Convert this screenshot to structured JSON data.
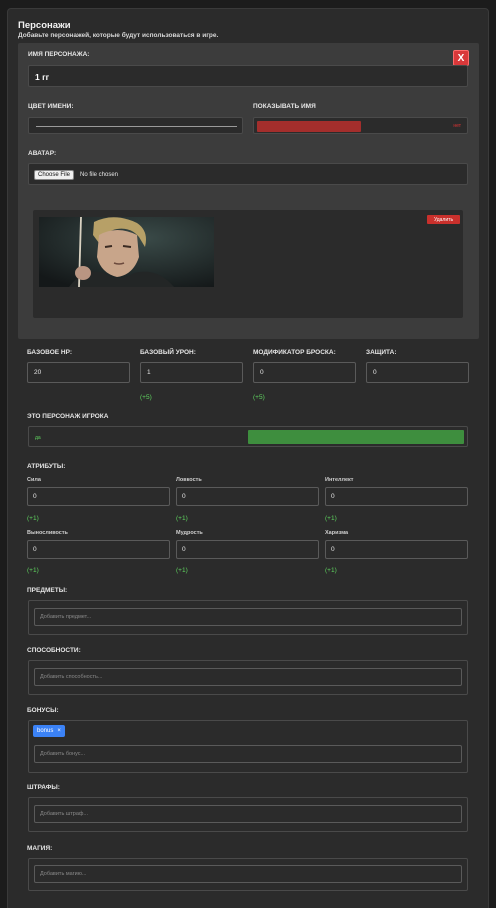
{
  "header": {
    "title": "Персонажи",
    "subtitle": "Добавьте персонажей, которые будут использоваться в игре."
  },
  "character": {
    "close_label": "X",
    "name_label": "ИМЯ ПЕРСОНАЖА:",
    "name_value": "1 гг",
    "name_color_label": "ЦВЕТ ИМЕНИ:",
    "show_name_label": "ПОКАЗЫВАТЬ ИМЯ",
    "show_name_state": "нет",
    "avatar_label": "АВАТАР:",
    "file_button": "Choose File",
    "file_status": "No file chosen",
    "delete_label": "Удалить"
  },
  "stats": [
    {
      "label": "БАЗОВОЕ HP:",
      "value": "20",
      "bonus": ""
    },
    {
      "label": "БАЗОВЫЙ УРОН:",
      "value": "1",
      "bonus": "(+5)"
    },
    {
      "label": "МОДИФИКАТОР БРОСКА:",
      "value": "0",
      "bonus": "(+5)"
    },
    {
      "label": "ЗАЩИТА:",
      "value": "0",
      "bonus": ""
    }
  ],
  "player": {
    "label": "ЭТО ПЕРСОНАЖ ИГРОКА",
    "state": "да"
  },
  "attributes": {
    "label": "АТРИБУТЫ:",
    "items": [
      {
        "label": "Сила",
        "value": "0",
        "bonus": "(+1)"
      },
      {
        "label": "Ловкость",
        "value": "0",
        "bonus": "(+1)"
      },
      {
        "label": "Интеллект",
        "value": "0",
        "bonus": "(+1)"
      },
      {
        "label": "Выносливость",
        "value": "0",
        "bonus": "(+1)"
      },
      {
        "label": "Мудрость",
        "value": "0",
        "bonus": "(+1)"
      },
      {
        "label": "Харизма",
        "value": "0",
        "bonus": "(+1)"
      }
    ]
  },
  "items": {
    "label": "ПРЕДМЕТЫ:",
    "placeholder": "Добавить предмет..."
  },
  "abilities": {
    "label": "СПОСОБНОСТИ:",
    "placeholder": "Добавить способность..."
  },
  "bonuses": {
    "label": "БОНУСЫ:",
    "tag": "bonus",
    "tag_remove": "×",
    "placeholder": "Добавить бонус..."
  },
  "penalties": {
    "label": "ШТРАФЫ:",
    "placeholder": "Добавить штраф..."
  },
  "magic": {
    "label": "МАГИЯ:",
    "placeholder": "Добавить магию..."
  }
}
